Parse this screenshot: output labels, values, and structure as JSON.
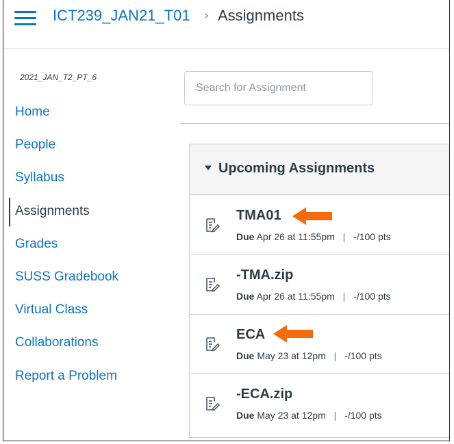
{
  "header": {
    "course": "ICT239_JAN21_T01",
    "separator": "›",
    "current": "Assignments"
  },
  "sidebar": {
    "term": "2021_JAN_T2_PT_6",
    "items": [
      {
        "label": "Home"
      },
      {
        "label": "People"
      },
      {
        "label": "Syllabus"
      },
      {
        "label": "Assignments"
      },
      {
        "label": "Grades"
      },
      {
        "label": "SUSS Gradebook"
      },
      {
        "label": "Virtual Class"
      },
      {
        "label": "Collaborations"
      },
      {
        "label": "Report a Problem"
      }
    ],
    "active_index": 3
  },
  "search": {
    "placeholder": "Search for Assignment"
  },
  "group": {
    "title": "Upcoming Assignments",
    "assignments": [
      {
        "title": "TMA01",
        "due_label": "Due",
        "due": "Apr 26 at 11:55pm",
        "separator": "|",
        "points": "-/100 pts",
        "highlighted": true
      },
      {
        "title": "-TMA.zip",
        "due_label": "Due",
        "due": "Apr 26 at 11:55pm",
        "separator": "|",
        "points": "-/100 pts",
        "highlighted": false
      },
      {
        "title": "ECA",
        "due_label": "Due",
        "due": "May 23 at 12pm",
        "separator": "|",
        "points": "-/100 pts",
        "highlighted": true
      },
      {
        "title": "-ECA.zip",
        "due_label": "Due",
        "due": "May 23 at 12pm",
        "separator": "|",
        "points": "-/100 pts",
        "highlighted": false
      }
    ]
  },
  "icons": {
    "menu": "hamburger-icon",
    "assignment": "assignment-icon",
    "collapse": "caret-down-icon",
    "annotation": "arrow-left-icon"
  },
  "colors": {
    "link": "#0b74c2",
    "text": "#2d3b45",
    "annotation_arrow": "#f46b0e"
  }
}
